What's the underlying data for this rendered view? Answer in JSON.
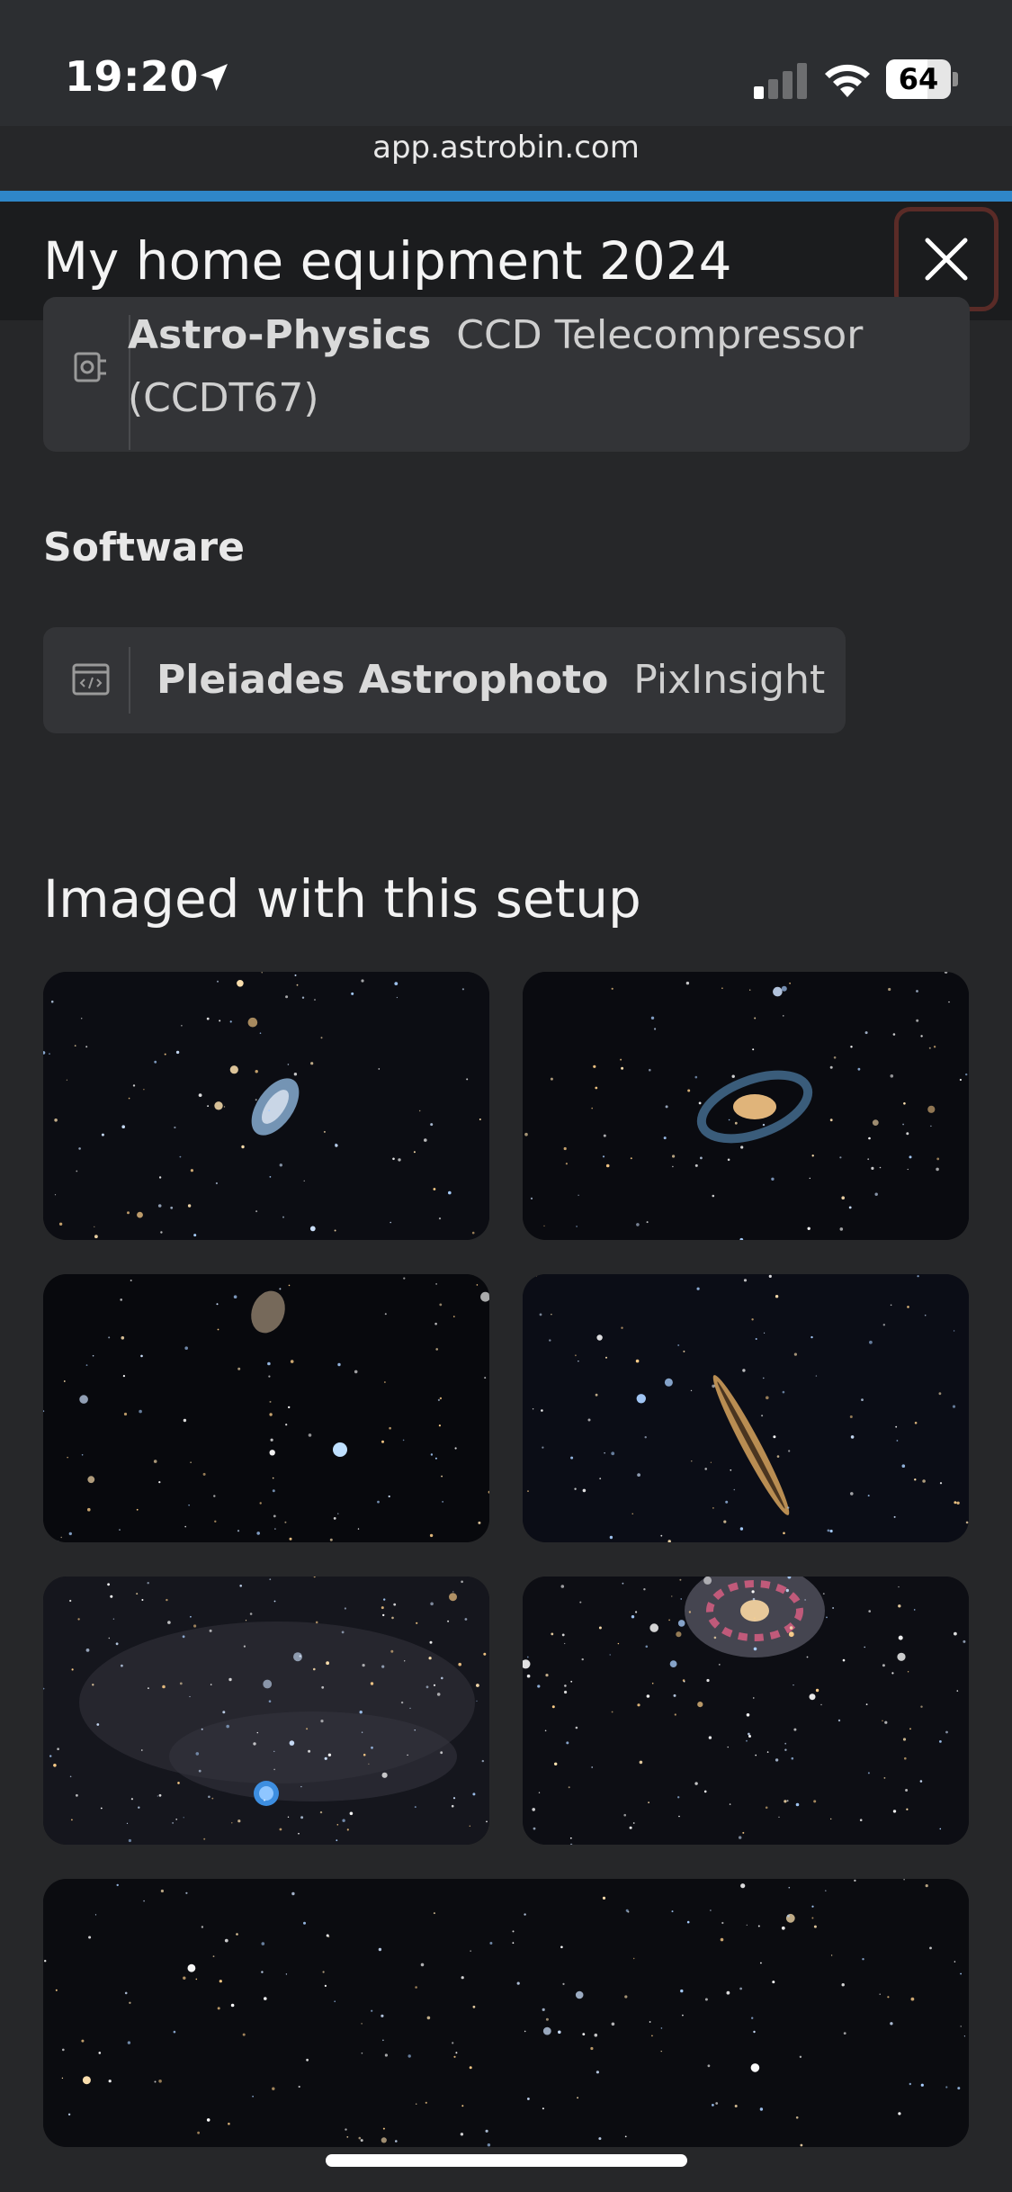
{
  "status_bar": {
    "time": "19:20",
    "battery": "64",
    "battery_level": 0.64,
    "signal_bars_active": 1,
    "location_icon": "location-arrow-icon",
    "wifi_icon": "wifi-icon"
  },
  "browser": {
    "url": "app.astrobin.com",
    "load_progress": 1.0,
    "progress_color": "#2f86c8"
  },
  "header": {
    "title": "My home equipment 2024",
    "close_icon": "close-icon"
  },
  "equipment_item": {
    "icon": "telecompressor-icon",
    "brand": "Astro-Physics",
    "product_line1": "CCD Telecompressor",
    "product_line2": "(CCDT67)"
  },
  "software": {
    "label": "Software",
    "item": {
      "icon": "software-window-icon",
      "brand": "Pleiades Astrophoto",
      "product": "PixInsight"
    }
  },
  "gallery": {
    "heading": "Imaged with this setup",
    "images": [
      {
        "subject": "galaxy-small"
      },
      {
        "subject": "spiral-galaxy"
      },
      {
        "subject": "interacting-galaxy"
      },
      {
        "subject": "edge-on-galaxy"
      },
      {
        "subject": "nebula-with-blue-planetary"
      },
      {
        "subject": "face-on-spiral-galaxy"
      },
      {
        "subject": "starfield"
      }
    ]
  }
}
